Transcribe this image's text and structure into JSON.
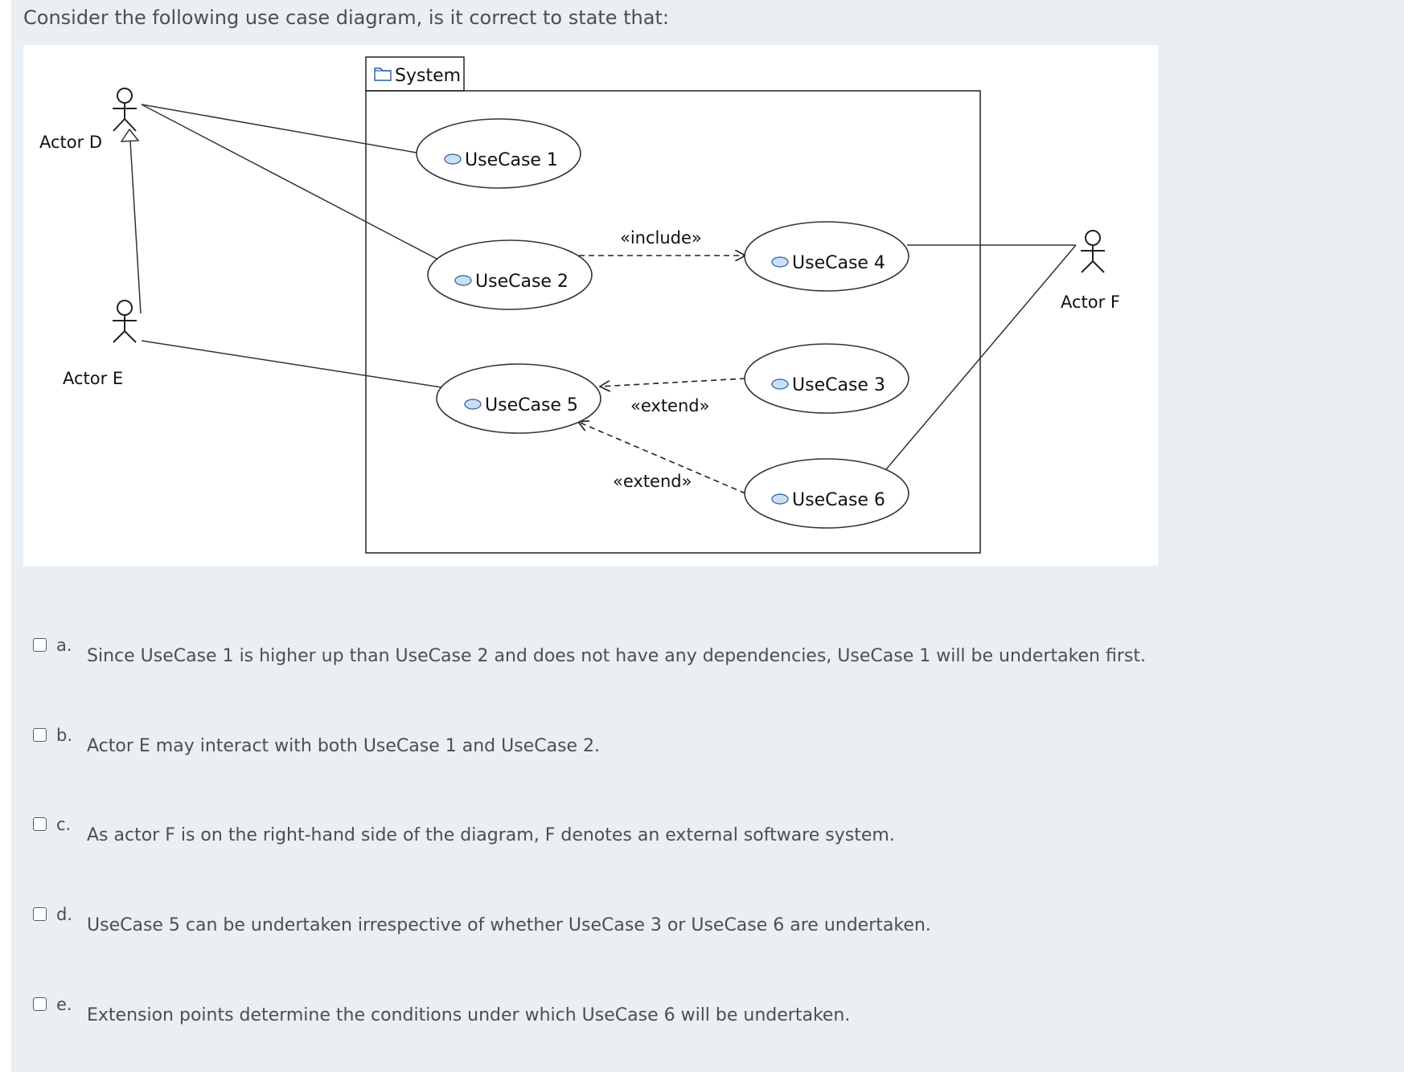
{
  "question": "Consider the following use case diagram, is it correct to state that:",
  "diagram": {
    "system_label": "System",
    "actors": [
      "Actor D",
      "Actor E",
      "Actor F"
    ],
    "use_cases": [
      "UseCase 1",
      "UseCase 2",
      "UseCase 3",
      "UseCase 4",
      "UseCase 5",
      "UseCase 6"
    ],
    "stereotypes": {
      "include": "«include»",
      "extend_upper": "«extend»",
      "extend_lower": "«extend»"
    }
  },
  "options": [
    {
      "letter": "a.",
      "text": "Since UseCase 1 is higher up than UseCase 2 and does not have any dependencies, UseCase 1 will be undertaken first."
    },
    {
      "letter": "b.",
      "text": "Actor E may interact with both UseCase 1 and UseCase 2."
    },
    {
      "letter": "c.",
      "text": "As actor F is on the right-hand side of the diagram, F denotes an external software system."
    },
    {
      "letter": "d.",
      "text": "UseCase 5 can be undertaken irrespective of whether UseCase 3 or UseCase 6 are undertaken."
    },
    {
      "letter": "e.",
      "text": "Extension points determine the conditions under which UseCase 6 will be undertaken."
    }
  ]
}
